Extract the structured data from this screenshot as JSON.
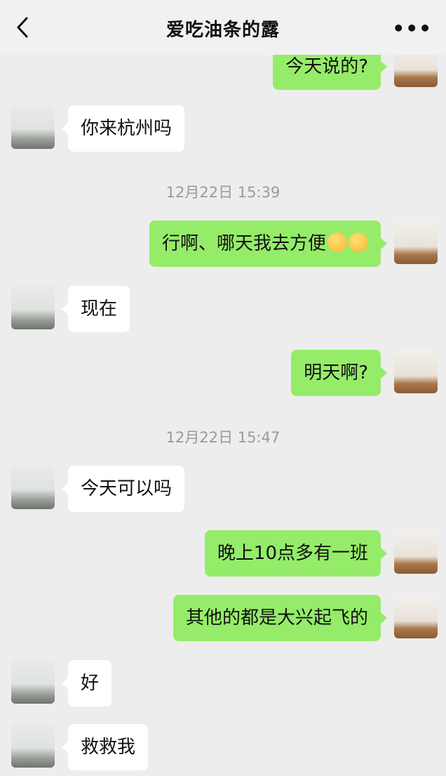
{
  "header": {
    "title": "爱吃油条的露",
    "more_label": "•••"
  },
  "icons": {
    "back": "chevron-left-icon",
    "more": "more-dots-icon",
    "emoji": "holding-back-laugh-emoji"
  },
  "colors": {
    "background": "#ededed",
    "sent_bubble": "#95ec69",
    "received_bubble": "#ffffff",
    "timestamp_text": "#9a9a9a"
  },
  "messages": [
    {
      "type": "sent",
      "text": "今天说的?"
    },
    {
      "type": "received",
      "text": "你来杭州吗"
    },
    {
      "type": "time",
      "text": "12月22日 15:39"
    },
    {
      "type": "sent",
      "text": "行啊、哪天我去方便"
    },
    {
      "type": "received",
      "text": "现在"
    },
    {
      "type": "sent",
      "text": "明天啊?"
    },
    {
      "type": "time",
      "text": "12月22日 15:47"
    },
    {
      "type": "received",
      "text": "今天可以吗"
    },
    {
      "type": "sent",
      "text": "晚上10点多有一班"
    },
    {
      "type": "sent",
      "text": "其他的都是大兴起飞的"
    },
    {
      "type": "received",
      "text": "好"
    },
    {
      "type": "received",
      "text": "救救我"
    }
  ]
}
